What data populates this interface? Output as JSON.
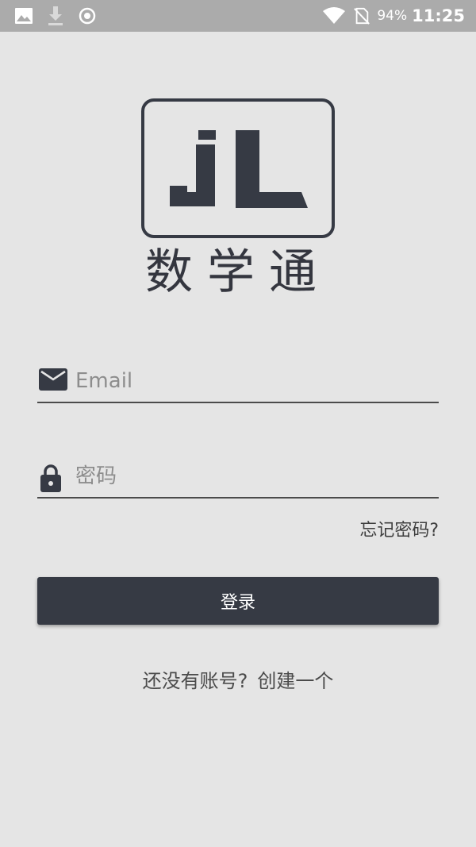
{
  "status_bar": {
    "battery": "94%",
    "time": "11:25",
    "left_icons": [
      "image-icon",
      "download-icon",
      "record-icon"
    ],
    "right_icons": [
      "wifi-icon",
      "no-sim-icon"
    ]
  },
  "logo": {
    "mark": "JL",
    "app_name": "数学通"
  },
  "form": {
    "email_placeholder": "Email",
    "email_value": "",
    "password_placeholder": "密码",
    "password_value": "",
    "forgot_label": "忘记密码?",
    "login_label": "登录"
  },
  "signup": {
    "prompt": "还没有账号?",
    "link_label": "创建一个"
  },
  "colors": {
    "background": "#e5e5e5",
    "status_bar": "#ababab",
    "accent_dark": "#363a44",
    "underline": "#4b4b4b",
    "placeholder": "#8d8d8d"
  }
}
